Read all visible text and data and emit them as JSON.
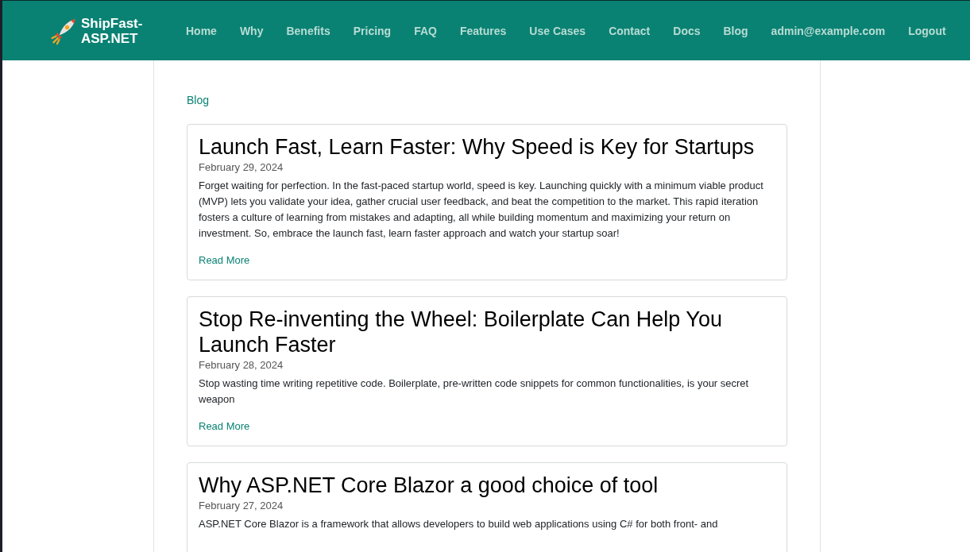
{
  "brand": {
    "name": "ShipFast-ASP.NET"
  },
  "nav": [
    {
      "label": "Home"
    },
    {
      "label": "Why"
    },
    {
      "label": "Benefits"
    },
    {
      "label": "Pricing"
    },
    {
      "label": "FAQ"
    },
    {
      "label": "Features"
    },
    {
      "label": "Use Cases"
    },
    {
      "label": "Contact"
    },
    {
      "label": "Docs"
    },
    {
      "label": "Blog"
    },
    {
      "label": "admin@example.com"
    },
    {
      "label": "Logout"
    }
  ],
  "breadcrumb": "Blog",
  "posts": [
    {
      "title": "Launch Fast, Learn Faster: Why Speed is Key for Startups",
      "date": "February 29, 2024",
      "excerpt": "Forget waiting for perfection. In the fast-paced startup world, speed is key. Launching quickly with a minimum viable product (MVP) lets you validate your idea, gather crucial user feedback, and beat the competition to the market. This rapid iteration fosters a culture of learning from mistakes and adapting, all while building momentum and maximizing your return on investment. So, embrace the launch fast, learn faster approach and watch your startup soar!",
      "link": "Read More"
    },
    {
      "title": "Stop Re-inventing the Wheel: Boilerplate Can Help You Launch Faster",
      "date": "February 28, 2024",
      "excerpt": "Stop wasting time writing repetitive code. Boilerplate, pre-written code snippets for common functionalities, is your secret weapon",
      "link": "Read More"
    },
    {
      "title": "Why ASP.NET Core Blazor a good choice of tool",
      "date": "February 27, 2024",
      "excerpt": "ASP.NET Core Blazor is a framework that allows developers to build web applications using C# for both front- and"
    }
  ]
}
